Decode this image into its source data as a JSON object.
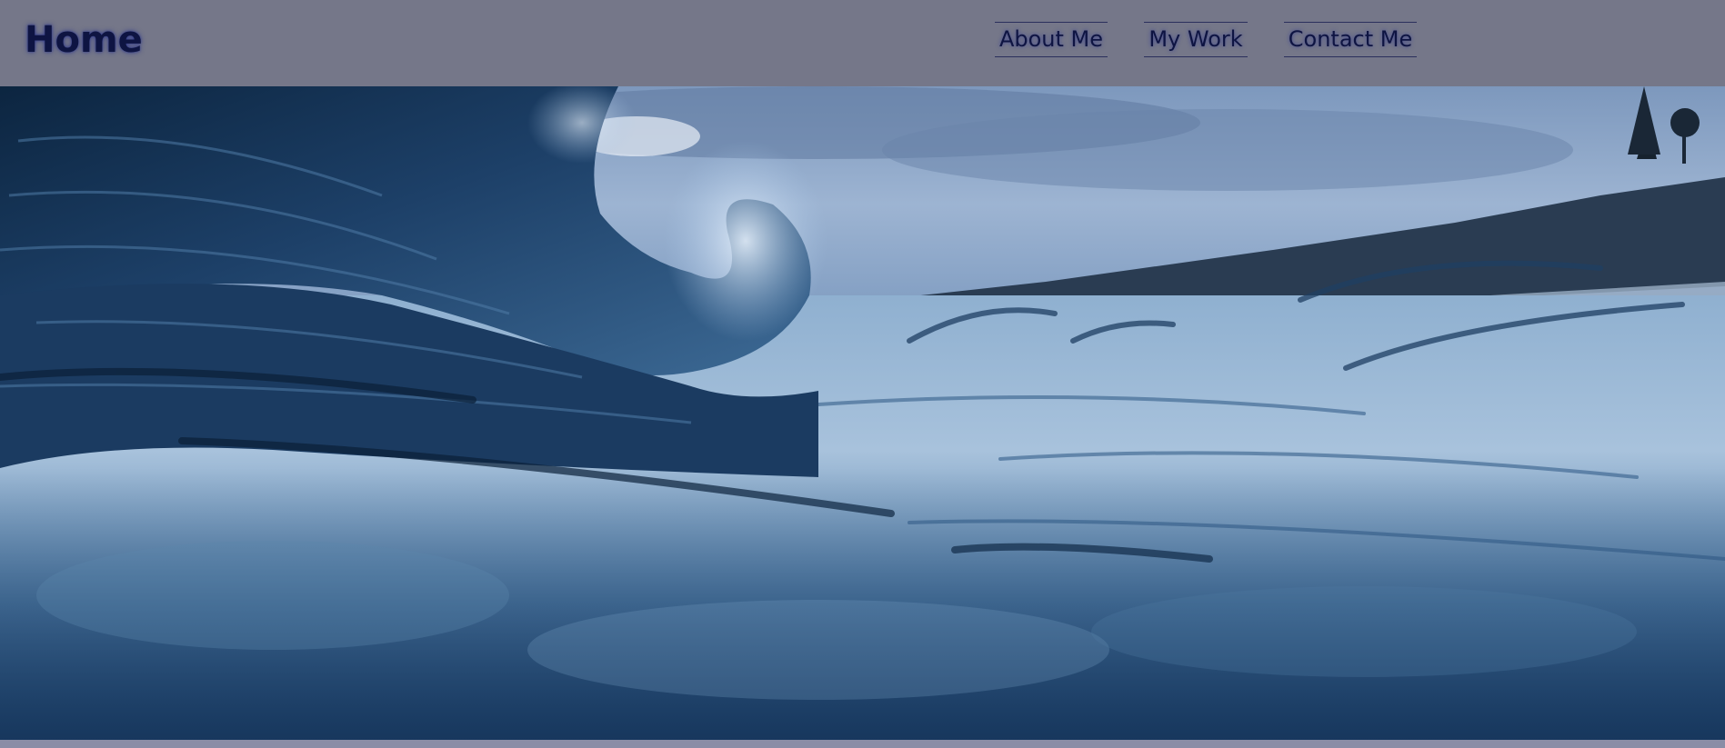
{
  "header": {
    "brand": "Home",
    "nav": [
      {
        "label": "About Me"
      },
      {
        "label": "My Work"
      },
      {
        "label": "Contact Me"
      }
    ]
  },
  "hero": {
    "image_subject": "ocean-wave-at-dusk",
    "colors": {
      "header_bg": "#757789",
      "nav_text": "#0e1442",
      "water_dark": "#0f2a4a",
      "water_mid": "#2d5a85",
      "water_light": "#a9c2da",
      "sky": "#6f8fb8"
    }
  }
}
